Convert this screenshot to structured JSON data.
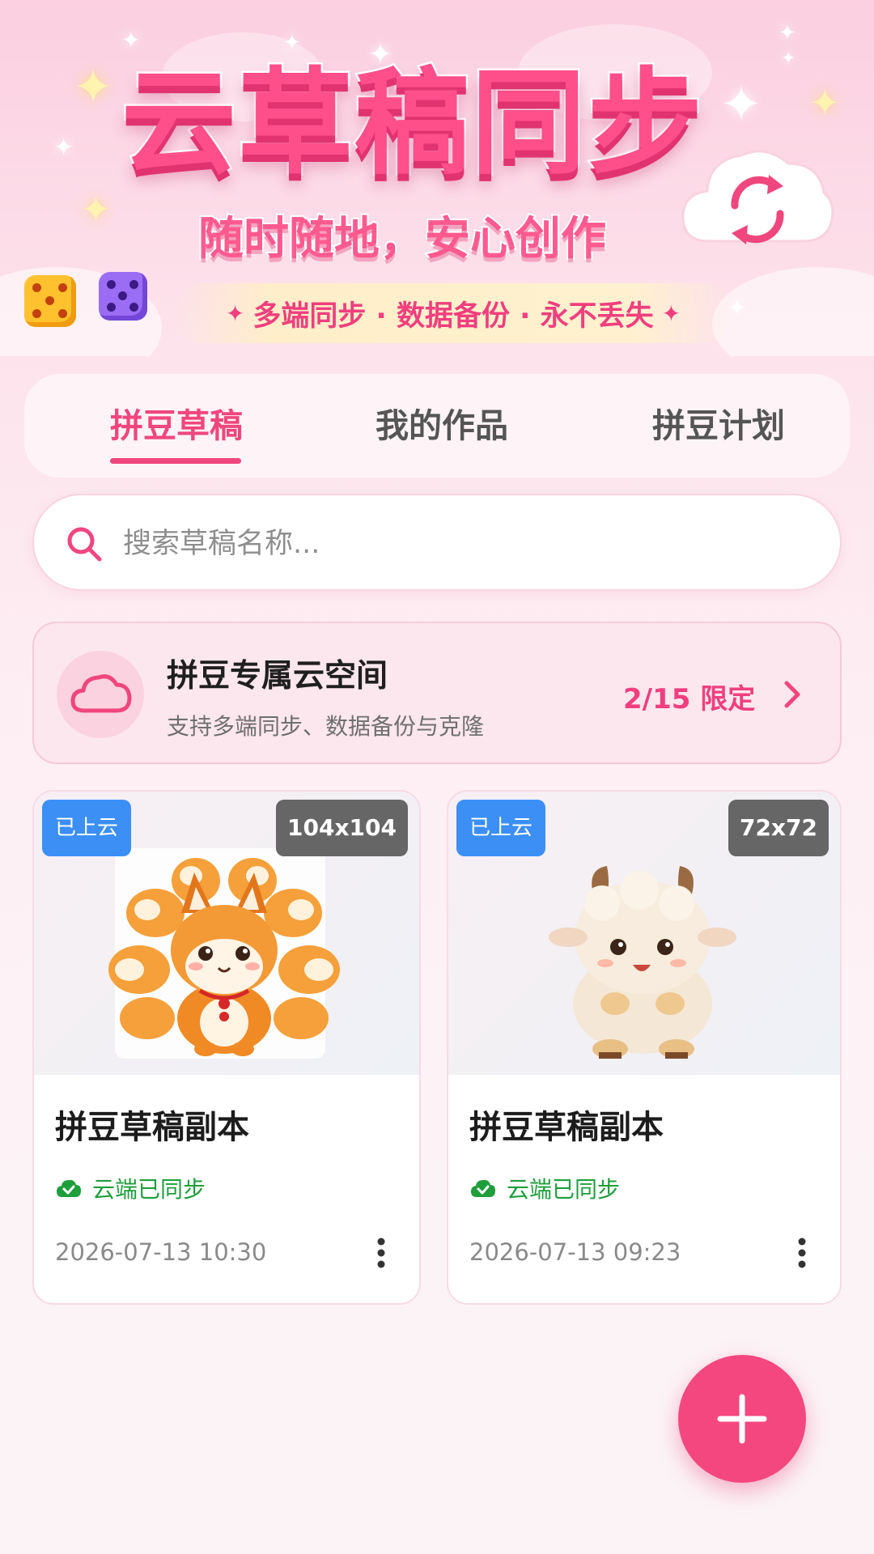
{
  "banner": {
    "title": "云草稿同步",
    "subtitle": "随时随地，安心创作",
    "ribbon": "多端同步 · 数据备份 · 永不丢失",
    "ribbon_star": "✦",
    "sync_icon": "sync-cloud-icon"
  },
  "tabs": [
    {
      "label": "拼豆草稿",
      "active": true
    },
    {
      "label": "我的作品",
      "active": false
    },
    {
      "label": "拼豆计划",
      "active": false
    }
  ],
  "search": {
    "placeholder": "搜索草稿名称...",
    "value": "",
    "icon": "search-icon"
  },
  "cloud_space": {
    "title": "拼豆专属云空间",
    "description": "支持多端同步、数据备份与克隆",
    "quota": "2/15 限定",
    "icon": "cloud-icon"
  },
  "drafts": [
    {
      "badge": "已上云",
      "size": "104x104",
      "title": "拼豆草稿副本",
      "status": "云端已同步",
      "date": "2026-07-13 10:30",
      "thumbnail": "pixel-fox-image"
    },
    {
      "badge": "已上云",
      "size": "72x72",
      "title": "拼豆草稿副本",
      "status": "云端已同步",
      "date": "2026-07-13 09:23",
      "thumbnail": "pixel-lamb-image"
    }
  ],
  "fab": {
    "icon": "plus-icon"
  },
  "colors": {
    "accent": "#f0467e",
    "badge_blue": "#3b8ff5",
    "badge_gray": "#666666",
    "success": "#1f9e3c",
    "card_pink": "#fde7ee"
  }
}
